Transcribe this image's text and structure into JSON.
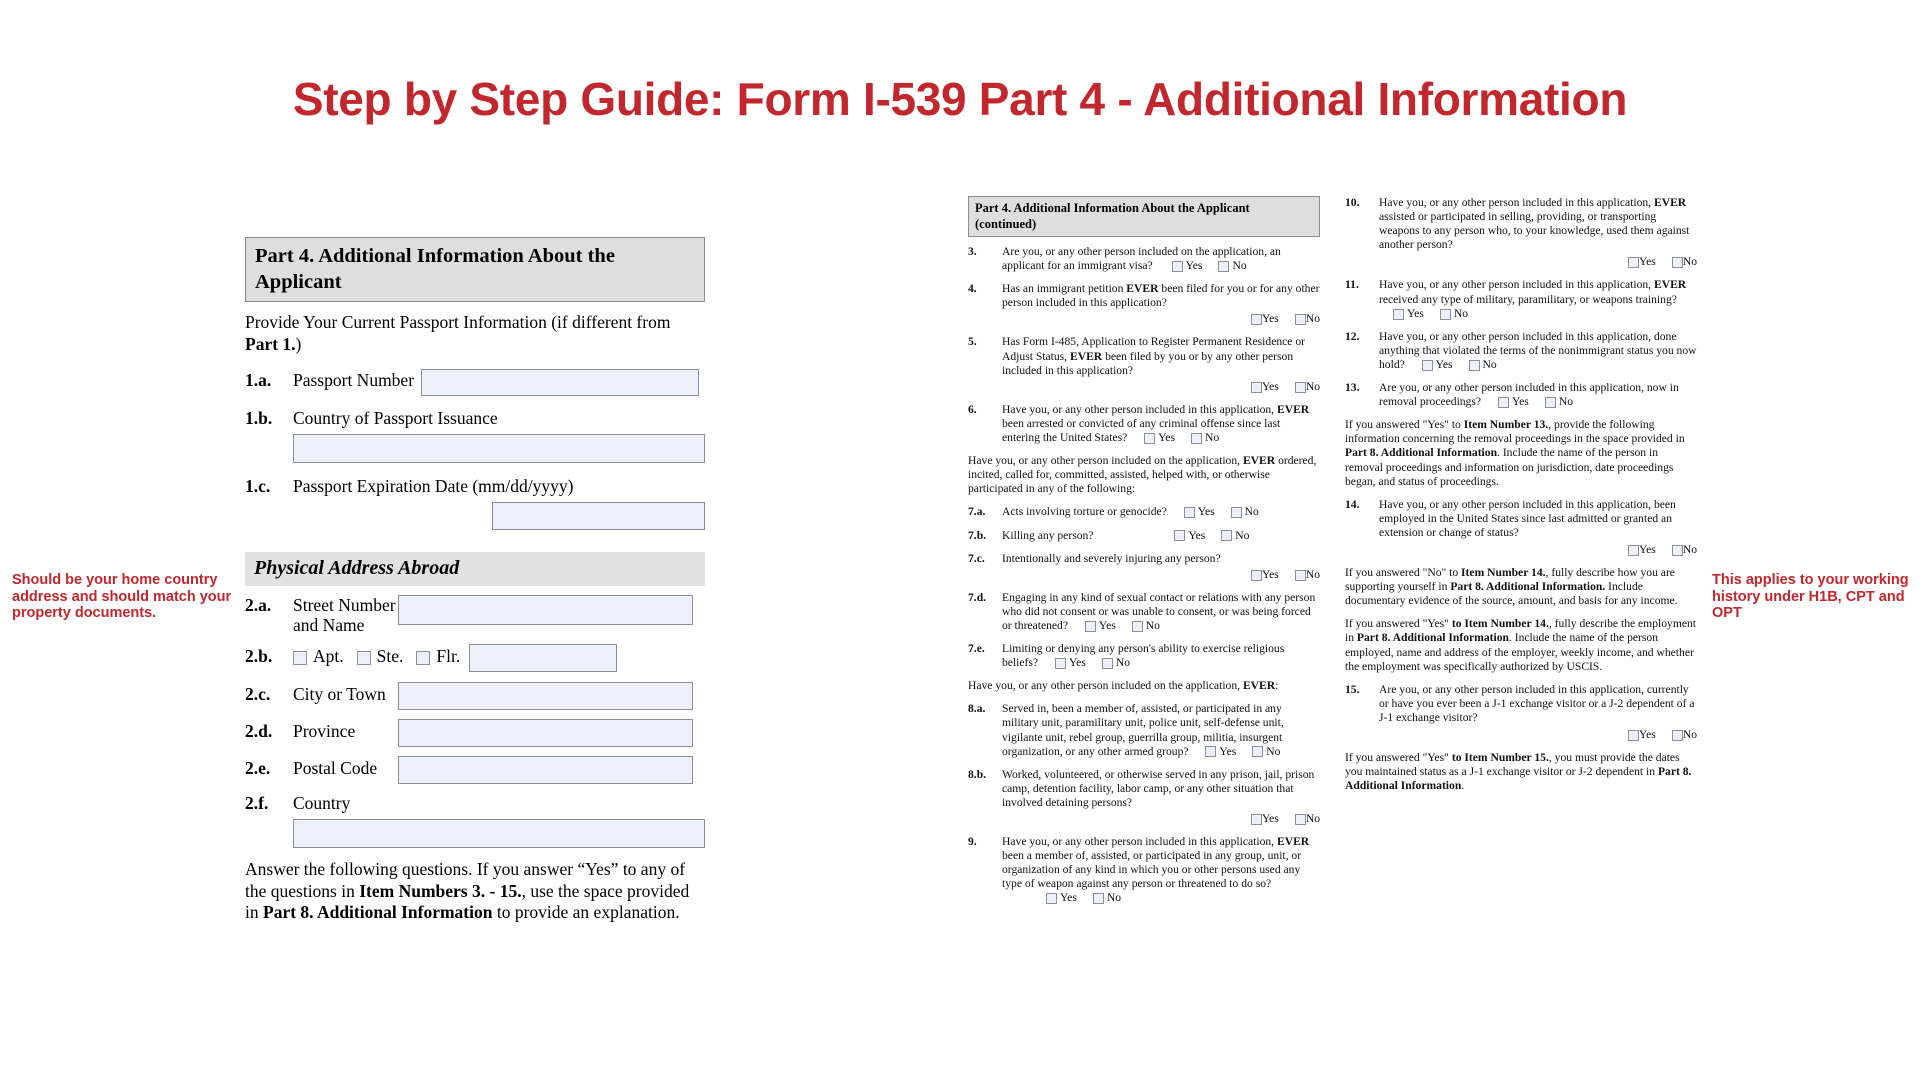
{
  "page": {
    "title": "Step by Step Guide: Form I-539 Part 4 - Additional Information",
    "accent_color": "#c1272d",
    "field_fill_color": "#edf0fa",
    "header_fill_color": "#dedede"
  },
  "left_panel": {
    "section_header": "Part 4.  Additional Information About the Applicant",
    "intro": {
      "text_1": "Provide Your Current Passport Information (if different from ",
      "text_bold": "Part 1.",
      "text_2": ")"
    },
    "items": [
      {
        "num": "1.a.",
        "label": "Passport Number"
      },
      {
        "num": "1.b.",
        "label": "Country of Passport Issuance"
      },
      {
        "num": "1.c.",
        "label": "Passport Expiration Date (mm/dd/yyyy)"
      }
    ],
    "subsection_header": "Physical Address Abroad",
    "address_items": [
      {
        "num": "2.a.",
        "label_line1": "Street Number",
        "label_line2": "and Name"
      },
      {
        "num": "2.b.",
        "checkboxes": [
          "Apt.",
          "Ste.",
          "Flr."
        ]
      },
      {
        "num": "2.c.",
        "label": "City or Town"
      },
      {
        "num": "2.d.",
        "label": "Province"
      },
      {
        "num": "2.e.",
        "label": "Postal Code"
      },
      {
        "num": "2.f.",
        "label": "Country"
      }
    ],
    "closing": {
      "p1": "Answer the following questions.   If you answer “Yes” to any of the questions in ",
      "b1": "Item Numbers 3. - 15.",
      "p2": ", use the space provided in ",
      "b2": "Part 8. Additional Information",
      "p3": " to provide an explanation."
    },
    "field_values": {
      "passport_number": "",
      "country_of_issuance": "",
      "expiration_date": "",
      "street": "",
      "apt_ste_flr": "",
      "city": "",
      "province": "",
      "postal_code": "",
      "country": ""
    }
  },
  "middle_panel": {
    "section_header": "Part 4.  Additional Information About the Applicant (continued)",
    "yes_label": "Yes",
    "no_label": "No",
    "questions": [
      {
        "num": "3.",
        "text": "Are you, or any other person included on the application, an applicant for an immigrant visa?",
        "yn_inline": true
      },
      {
        "num": "4.",
        "text_pre": "Has an immigrant petition ",
        "bold": "EVER",
        "text_post": " been filed for you or for any other person included in this application?",
        "yn_inline": false
      },
      {
        "num": "5.",
        "text_pre": "Has Form I-485, Application to Register Permanent Residence or Adjust Status, ",
        "bold": "EVER",
        "text_post": " been filed by you or by any other person included in this application?",
        "yn_inline": false
      },
      {
        "num": "6.",
        "text_pre": "Have you, or any other person included in this application, ",
        "bold": "EVER",
        "text_post": " been arrested or convicted of any criminal offense since last entering the United States?",
        "yn_inline": true
      }
    ],
    "lead_in_7": {
      "pre": "Have you, or any other person included on the application, ",
      "bold": "EVER",
      "post": " ordered, incited, called for, committed, assisted, helped with, or otherwise participated in any of the following:"
    },
    "questions_7": [
      {
        "num": "7.a.",
        "text": "Acts involving torture or genocide?",
        "yn_inline": true
      },
      {
        "num": "7.b.",
        "text": "Killing any person?",
        "yn_inline": true
      },
      {
        "num": "7.c.",
        "text": "Intentionally and severely injuring any person?",
        "yn_inline": false
      },
      {
        "num": "7.d.",
        "text": "Engaging in any kind of sexual contact or relations with any person who did not consent or was unable to consent, or was being forced or threatened?",
        "yn_inline": true
      },
      {
        "num": "7.e.",
        "text": "Limiting or denying any person's ability to exercise religious beliefs?",
        "yn_inline": true
      }
    ],
    "lead_in_8": {
      "pre": "Have you, or any other person included on the application, ",
      "bold": "EVER",
      "post": ":"
    },
    "questions_8": [
      {
        "num": "8.a.",
        "text": "Served in, been a member of, assisted, or participated in any military unit, paramilitary unit, police unit, self-defense unit, vigilante unit, rebel group, guerrilla group, militia, insurgent organization, or any other armed group?",
        "yn_inline": true
      },
      {
        "num": "8.b.",
        "text": "Worked, volunteered, or otherwise served in any prison, jail, prison camp, detention facility, labor camp, or any other situation that involved detaining persons?",
        "yn_inline": false
      },
      {
        "num": "9.",
        "text_pre": "Have you, or any other person included in this application, ",
        "bold": "EVER",
        "text_post": " been a member of, assisted, or participated in any group, unit, or organization of any kind in which you or other persons used any type of weapon against any person or threatened to do so?",
        "yn_inline": true
      }
    ]
  },
  "right_panel": {
    "yes_label": "Yes",
    "no_label": "No",
    "questions": [
      {
        "num": "10.",
        "text_pre": "Have you, or any other person included in this application, ",
        "bold": "EVER",
        "text_post": " assisted or participated in selling, providing, or transporting weapons to any person who, to your knowledge, used them against another person?",
        "yn_inline": false
      },
      {
        "num": "11.",
        "text_pre": "Have you, or any other person included in this application, ",
        "bold": "EVER",
        "text_post": " received any type of military, paramilitary, or weapons training?",
        "yn_inline": true
      },
      {
        "num": "12.",
        "text_pre": "Have you, or any other person included in this application, done anything that violated the terms of the nonimmigrant status you now hold?",
        "bold": "",
        "text_post": "",
        "yn_inline": true
      },
      {
        "num": "13.",
        "text_pre": "Are you, or any other person included in this application, now in removal proceedings?",
        "bold": "",
        "text_post": "",
        "yn_inline": true
      }
    ],
    "para_13": {
      "t1": "If you answered \"Yes\" to ",
      "b1": "Item Number 13.",
      "t2": ", provide the following information concerning the removal proceedings in the space provided in ",
      "b2": "Part 8. Additional Information",
      "t3": ".  Include the name of the person in removal proceedings and information on jurisdiction, date proceedings began, and status of proceedings."
    },
    "question_14": {
      "num": "14.",
      "text": "Have you, or any other person included in this application, been employed in the United States since last admitted or granted an extension or change of status?"
    },
    "para_14_no": {
      "t1": "If you answered \"No\" to ",
      "b1": "Item Number 14.",
      "t2": ", fully describe how you are supporting yourself in ",
      "b2": "Part 8. Additional Information.",
      "t3": "  Include documentary evidence of the source, amount, and basis for any income."
    },
    "para_14_yes": {
      "t1": "If you answered \"Yes\" ",
      "b1": "to Item Number 14.",
      "t2": ", fully describe the employment in ",
      "b2": "Part 8. Additional Information",
      "t3": ".  Include the name of the person employed, name and address of the employer, weekly income, and whether the employment was specifically authorized by USCIS."
    },
    "question_15": {
      "num": "15.",
      "text": "Are you, or any other person included in this application, currently or have you ever been a J-1 exchange visitor or a J-2 dependent of a J-1 exchange visitor?"
    },
    "para_15": {
      "t1": "If you answered \"Yes\" ",
      "b1": "to Item Number 15.",
      "t2": ", you must provide the dates you maintained status as a J-1 exchange visitor or J-2 dependent in ",
      "b2": "Part 8. Additional Information",
      "t3": "."
    }
  },
  "annotations": {
    "left": "Should be your home country address and should match your property documents.",
    "right": "This applies to your working history under H1B, CPT and OPT"
  }
}
